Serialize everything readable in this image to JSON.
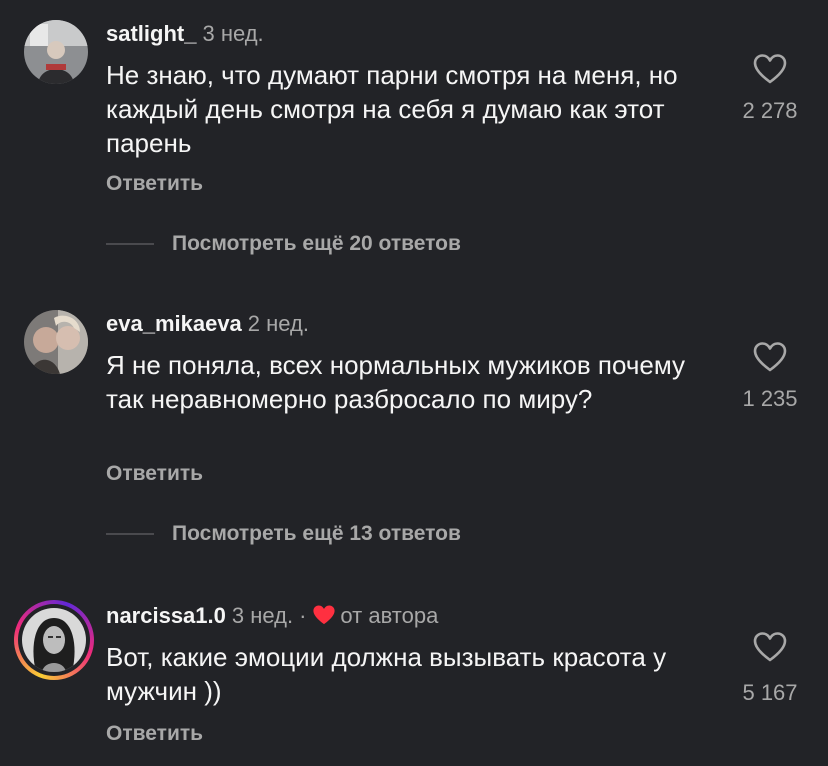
{
  "comments": [
    {
      "username": "satlight_",
      "time": "3 нед.",
      "text": "Не знаю, что думают парни смотря на меня, но каждый день смотря на себя я думаю как этот парень",
      "reply_label": "Ответить",
      "likes": "2 278",
      "more_replies": "Посмотреть ещё 20 ответов"
    },
    {
      "username": "eva_mikaeva",
      "time": "2 нед.",
      "text": "Я не поняла, всех нормальных мужиков почему так неравномерно разбросало по миру?",
      "reply_label": "Ответить",
      "likes": "1 235",
      "more_replies": "Посмотреть ещё 13 ответов"
    },
    {
      "username": "narcissa1.0",
      "time": "3 нед.",
      "separator": "·",
      "author_label": "от автора",
      "text": "Вот, какие эмоции должна вызывать красота у мужчин ))",
      "reply_label": "Ответить",
      "likes": "5 167"
    }
  ],
  "colors": {
    "background": "#222327",
    "primary_text": "#f5f5f5",
    "secondary_text": "#a8a8a8",
    "author_heart": "#ff3040"
  },
  "icons": {
    "like": "heart-outline-icon",
    "author_like": "heart-filled-icon"
  }
}
